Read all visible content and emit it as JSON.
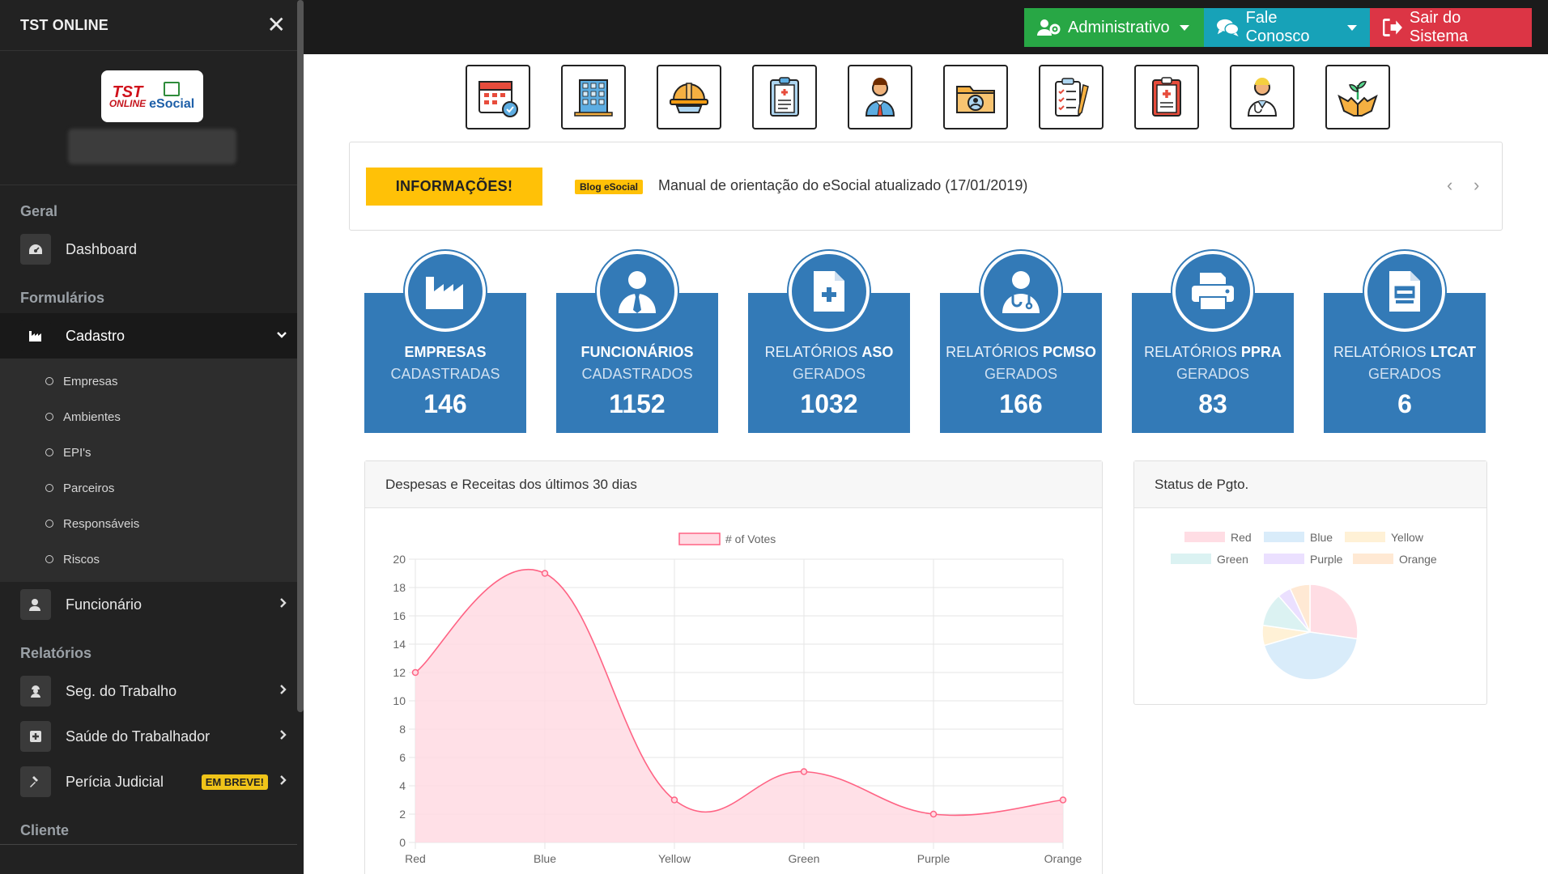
{
  "sidebar": {
    "title": "TST ONLINE",
    "logo": {
      "brand_top": "TST",
      "brand_bottom": "ONLINE",
      "brand_right": "eSocial"
    },
    "sections": {
      "geral": "Geral",
      "formularios": "Formulários",
      "relatorios": "Relatórios",
      "cliente": "Cliente"
    },
    "items": {
      "dashboard": "Dashboard",
      "cadastro": "Cadastro",
      "funcionario": "Funcionário",
      "seg_trabalho": "Seg. do Trabalho",
      "saude_trabalhador": "Saúde do Trabalhador",
      "pericia_judicial": "Perícia Judicial"
    },
    "cadastro_sub": [
      "Empresas",
      "Ambientes",
      "EPI's",
      "Parceiros",
      "Responsáveis",
      "Riscos"
    ],
    "badge_soon": "EM BREVE!"
  },
  "topbar": {
    "admin": "Administrativo",
    "fale": "Fale Conosco",
    "sair": "Sair do Sistema"
  },
  "quick_icons": [
    "calendar-check-icon",
    "building-icon",
    "hard-hat-icon",
    "clipboard-report-icon",
    "employee-icon",
    "folder-user-icon",
    "checklist-icon",
    "medical-clipboard-icon",
    "doctor-icon",
    "plant-hands-icon"
  ],
  "info": {
    "tag": "INFORMAÇÕES!",
    "blog_badge": "Blog eSocial",
    "text": "Manual de orientação do eSocial atualizado (17/01/2019)",
    "prev": "‹",
    "next": "›"
  },
  "stats": [
    {
      "bold": "EMPRESAS",
      "pre": "",
      "line2": "CADASTRADAS",
      "value": "146",
      "icon": "factory-icon"
    },
    {
      "bold": "FUNCIONÁRIOS",
      "pre": "",
      "line2": "CADASTRADOS",
      "value": "1152",
      "icon": "user-tie-icon"
    },
    {
      "bold": "ASO",
      "pre": "RELATÓRIOS ",
      "line2": "GERADOS",
      "value": "1032",
      "icon": "file-medical-icon"
    },
    {
      "bold": "PCMSO",
      "pre": "RELATÓRIOS ",
      "line2": "GERADOS",
      "value": "166",
      "icon": "user-doctor-icon"
    },
    {
      "bold": "PPRA",
      "pre": "RELATÓRIOS ",
      "line2": "GERADOS",
      "value": "83",
      "icon": "printer-icon"
    },
    {
      "bold": "LTCAT",
      "pre": "RELATÓRIOS ",
      "line2": "GERADOS",
      "value": "6",
      "icon": "file-alt-icon"
    }
  ],
  "line_panel": {
    "title": "Despesas e Receitas dos últimos 30 dias"
  },
  "pie_panel": {
    "title": "Status de Pgto."
  },
  "chart_data": [
    {
      "type": "area",
      "categories": [
        "Red",
        "Blue",
        "Yellow",
        "Green",
        "Purple",
        "Orange"
      ],
      "series": [
        {
          "name": "# of Votes",
          "values": [
            12,
            19,
            3,
            5,
            2,
            3
          ]
        }
      ],
      "ylim": [
        0,
        20
      ],
      "yticks": [
        0,
        2,
        4,
        6,
        8,
        10,
        12,
        14,
        16,
        18,
        20
      ],
      "grid": true,
      "legend": "top",
      "color": "#ff6384",
      "fill": "#ffdbe3"
    },
    {
      "type": "pie",
      "categories": [
        "Red",
        "Blue",
        "Yellow",
        "Green",
        "Purple",
        "Orange"
      ],
      "values": [
        12,
        19,
        3,
        5,
        2,
        3
      ],
      "colors": [
        "#ffdde4",
        "#d9ecfa",
        "#fff1d6",
        "#dbf2f2",
        "#ebe0ff",
        "#ffe9d4"
      ],
      "legend": "top"
    }
  ]
}
